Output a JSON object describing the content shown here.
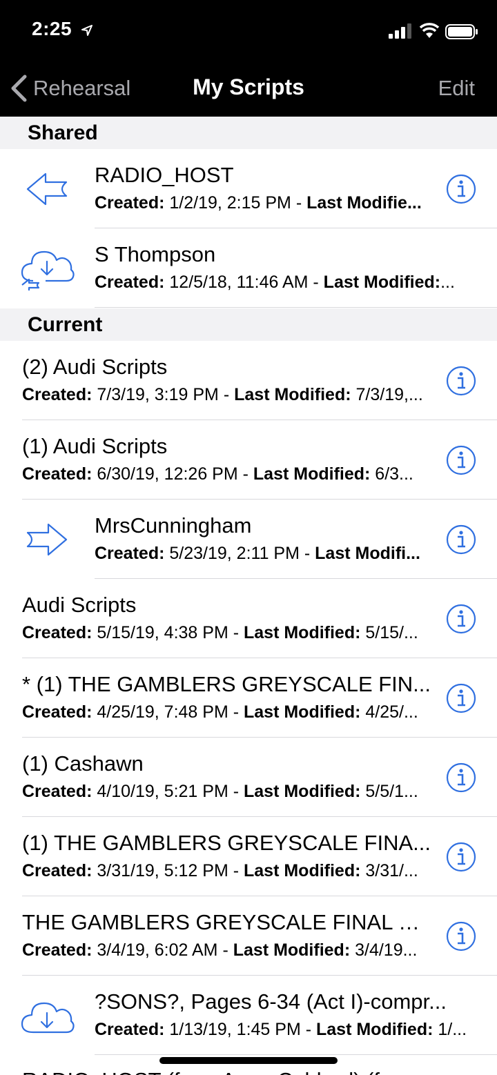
{
  "status": {
    "time": "2:25"
  },
  "nav": {
    "back_label": "Rehearsal",
    "title": "My Scripts",
    "edit_label": "Edit"
  },
  "sections": {
    "shared": "Shared",
    "current": "Current"
  },
  "labels": {
    "created": "Created:",
    "modified": "Last Modified:"
  },
  "shared": [
    {
      "title": "RADIO_HOST",
      "created": "1/2/19, 2:15 PM",
      "sub_tail": " - ",
      "modified_label": "Last Modifie...",
      "modified": "",
      "icon": "share-arrow-left-icon",
      "info": true
    },
    {
      "title": "S Thompson",
      "created": "12/5/18, 11:46 AM",
      "sub_tail": " - ",
      "modified_label": "Last Modified:",
      "modified": "...",
      "icon": "cloud-download-shared-icon",
      "info": false
    }
  ],
  "current": [
    {
      "title": "(2) Audi Scripts",
      "created": "7/3/19, 3:19 PM",
      "sub_tail": " - ",
      "modified_label": "Last Modified:",
      "modified": " 7/3/19,...",
      "icon": "",
      "info": true
    },
    {
      "title": "(1) Audi Scripts",
      "created": "6/30/19, 12:26 PM",
      "sub_tail": " - ",
      "modified_label": "Last Modified:",
      "modified": " 6/3...",
      "icon": "",
      "info": true
    },
    {
      "title": "MrsCunningham",
      "created": "5/23/19, 2:11 PM",
      "sub_tail": " - ",
      "modified_label": "Last Modifi...",
      "modified": "",
      "icon": "share-arrow-right-icon",
      "info": true
    },
    {
      "title": "Audi Scripts",
      "created": "5/15/19, 4:38 PM",
      "sub_tail": " - ",
      "modified_label": "Last Modified:",
      "modified": " 5/15/...",
      "icon": "",
      "info": true
    },
    {
      "title": "* (1) THE GAMBLERS GREYSCALE FIN...",
      "created": "4/25/19, 7:48 PM",
      "sub_tail": " - ",
      "modified_label": "Last Modified:",
      "modified": " 4/25/...",
      "icon": "",
      "info": true
    },
    {
      "title": "(1) Cashawn",
      "created": "4/10/19, 5:21 PM",
      "sub_tail": " - ",
      "modified_label": "Last Modified:",
      "modified": " 5/5/1...",
      "icon": "",
      "info": true
    },
    {
      "title": "(1) THE GAMBLERS GREYSCALE FINA...",
      "created": "3/31/19, 5:12 PM",
      "sub_tail": " - ",
      "modified_label": "Last Modified:",
      "modified": " 3/31/...",
      "icon": "",
      "info": true
    },
    {
      "title": "THE GAMBLERS GREYSCALE FINAL D...",
      "created": "3/4/19, 6:02 AM",
      "sub_tail": " - ",
      "modified_label": "Last Modified:",
      "modified": " 3/4/19...",
      "icon": "",
      "info": true
    },
    {
      "title": "?SONS?, Pages 6-34 (Act I)-compr...",
      "created": "1/13/19, 1:45 PM",
      "sub_tail": " - ",
      "modified_label": "Last Modified:",
      "modified": " 1/...",
      "icon": "cloud-download-icon",
      "info": false
    }
  ],
  "peek_text": "RADIO_HOST (from Anne Caldwel) (f",
  "colors": {
    "accent": "#2f6fe0",
    "nav_bg": "#000000",
    "section_bg": "#f2f2f4",
    "separator": "#d8d8dc",
    "nav_gray": "#a9a9ae"
  }
}
